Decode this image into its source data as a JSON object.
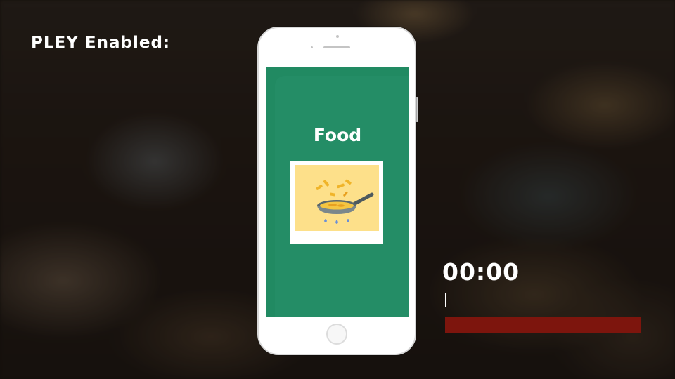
{
  "overlay": {
    "headline": "PLEY Enabled:"
  },
  "phone": {
    "screen": {
      "title": "Food",
      "background_color": "#218a62",
      "image_icon": "frying-pan-icon"
    }
  },
  "timer": {
    "time": "00:00",
    "progress": 0,
    "bar_color": "#7d150d"
  }
}
